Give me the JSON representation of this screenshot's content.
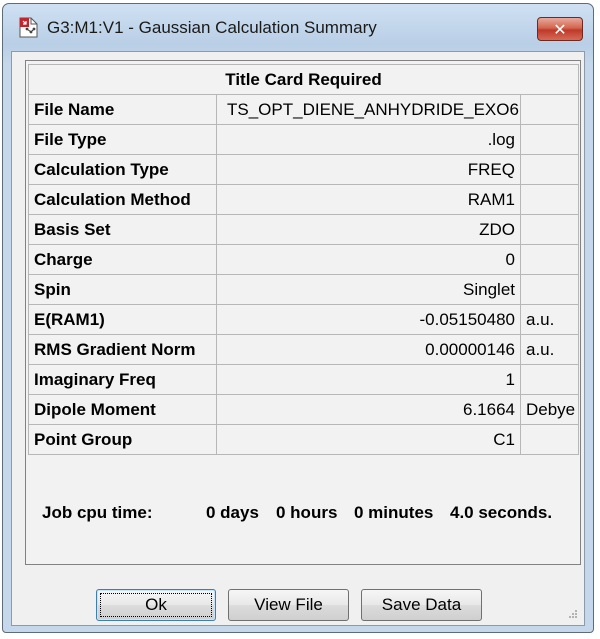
{
  "window": {
    "title": "G3:M1:V1 - Gaussian Calculation Summary",
    "close_label": "✕"
  },
  "table": {
    "header": "Title Card Required",
    "rows": [
      {
        "label": "File Name",
        "value": "TS_OPT_DIENE_ANHYDRIDE_EXO6",
        "unit": ""
      },
      {
        "label": "File Type",
        "value": ".log",
        "unit": ""
      },
      {
        "label": "Calculation Type",
        "value": "FREQ",
        "unit": ""
      },
      {
        "label": "Calculation Method",
        "value": "RAM1",
        "unit": ""
      },
      {
        "label": "Basis Set",
        "value": "ZDO",
        "unit": ""
      },
      {
        "label": "Charge",
        "value": "0",
        "unit": ""
      },
      {
        "label": "Spin",
        "value": "Singlet",
        "unit": ""
      },
      {
        "label": "E(RAM1)",
        "value": "-0.05150480",
        "unit": "a.u."
      },
      {
        "label": "RMS Gradient Norm",
        "value": "0.00000146",
        "unit": "a.u."
      },
      {
        "label": "Imaginary Freq",
        "value": "1",
        "unit": ""
      },
      {
        "label": "Dipole Moment",
        "value": "6.1664",
        "unit": "Debye"
      },
      {
        "label": "Point Group",
        "value": "C1",
        "unit": ""
      }
    ]
  },
  "cpu": {
    "label": "Job cpu time:",
    "days": "0 days",
    "hours": "0 hours",
    "minutes": "0 minutes",
    "seconds": "4.0 seconds."
  },
  "buttons": {
    "ok": "Ok",
    "view_file": "View File",
    "save_data": "Save Data"
  },
  "icons": {
    "app": "gaussview-document-icon",
    "close": "close-icon",
    "grip": "resize-grip-icon"
  }
}
